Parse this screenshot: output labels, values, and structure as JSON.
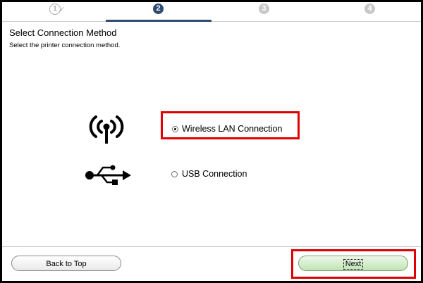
{
  "steps": {
    "items": [
      "1",
      "2",
      "3",
      "4"
    ],
    "completed_mark": "✓",
    "current": 2
  },
  "header": {
    "title": "Select Connection Method",
    "subtitle": "Select the printer connection method."
  },
  "options": {
    "wireless": {
      "label": "Wireless LAN Connection",
      "selected": true,
      "icon": "wireless-signal-icon"
    },
    "usb": {
      "label": "USB Connection",
      "selected": false,
      "icon": "usb-icon"
    }
  },
  "footer": {
    "back_label": "Back to Top",
    "next_label": "Next"
  },
  "colors": {
    "highlight": "#e00000",
    "step_active": "#2f4a72",
    "step_inactive": "#c8c8c8",
    "next_button": "#cfe9c6"
  }
}
